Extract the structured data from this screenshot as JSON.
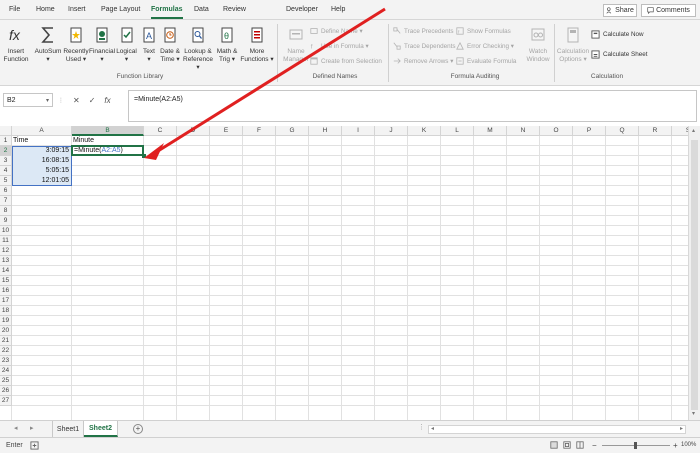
{
  "menu": {
    "tabs": [
      "File",
      "Home",
      "Insert",
      "Page Layout",
      "Formulas",
      "Data",
      "Review",
      "Developer",
      "Help"
    ],
    "active_tab": "Formulas",
    "share_label": "Share",
    "comments_label": "Comments"
  },
  "ribbon": {
    "function_library": {
      "insert_function": "Insert\nFunction",
      "autosum": "AutoSum\n▾",
      "recently_used": "Recently\nUsed ▾",
      "financial": "Financial\n▾",
      "logical": "Logical\n▾",
      "text": "Text\n▾",
      "date_time": "Date &\nTime ▾",
      "lookup_reference": "Lookup &\nReference ▾",
      "math_trig": "Math &\nTrig ▾",
      "more_functions": "More\nFunctions ▾",
      "group_label": "Function Library"
    },
    "defined_names": {
      "name_manager": "Name\nManager",
      "define_name": "Define Name ▾",
      "use_in_formula": "Use in Formula ▾",
      "create_from_selection": "Create from Selection",
      "group_label": "Defined Names"
    },
    "formula_auditing": {
      "trace_precedents": "Trace Precedents",
      "trace_dependents": "Trace Dependents",
      "remove_arrows": "Remove Arrows ▾",
      "show_formulas": "Show Formulas",
      "error_checking": "Error Checking ▾",
      "evaluate_formula": "Evaluate Formula",
      "watch_window": "Watch\nWindow",
      "group_label": "Formula Auditing"
    },
    "calculation": {
      "calculation_options": "Calculation\nOptions ▾",
      "calculate_now": "Calculate Now",
      "calculate_sheet": "Calculate Sheet",
      "group_label": "Calculation"
    }
  },
  "formula_bar": {
    "name_box": "B2",
    "cancel": "✕",
    "enter": "✓",
    "fx": "fx",
    "content": "=Minute(A2:A5)"
  },
  "grid": {
    "columns": [
      "A",
      "B",
      "C",
      "D",
      "E",
      "F",
      "G",
      "H",
      "I",
      "J",
      "K",
      "L",
      "M",
      "N",
      "O",
      "P",
      "Q",
      "R",
      "S"
    ],
    "rows": [
      "1",
      "2",
      "3",
      "4",
      "5",
      "6",
      "7",
      "8",
      "9",
      "10",
      "11",
      "12",
      "13",
      "14",
      "15",
      "16",
      "17",
      "18",
      "19",
      "20",
      "21",
      "22",
      "23",
      "24",
      "25",
      "26",
      "27"
    ],
    "cells": {
      "A1": "Time",
      "B1": "Minute",
      "A2": "3:09:15",
      "A3": "16:08:15",
      "A4": "5:05:15",
      "A5": "12:01:05",
      "B2_prefix": "=Minute(",
      "B2_ref": "A2:A5",
      "B2_suffix": ")"
    },
    "ref_color": "#4472c4",
    "accent_color": "#217346",
    "arrow_color": "#e02020"
  },
  "sheets": {
    "tabs": [
      "Sheet1",
      "Sheet2"
    ],
    "active": "Sheet2",
    "add_label": "+"
  },
  "status": {
    "mode": "Enter",
    "zoom": "100%"
  }
}
